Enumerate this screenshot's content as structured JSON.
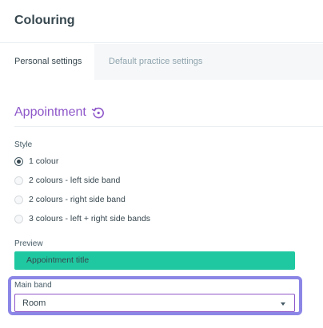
{
  "header": {
    "title": "Colouring"
  },
  "tabs": [
    {
      "label": "Personal settings",
      "active": true
    },
    {
      "label": "Default practice settings",
      "active": false
    }
  ],
  "section": {
    "title": "Appointment",
    "icon": "refresh-icon"
  },
  "style": {
    "label": "Style",
    "options": [
      {
        "label": "1 colour",
        "checked": true
      },
      {
        "label": "2 colours - left side band",
        "checked": false
      },
      {
        "label": "2 colours - right side band",
        "checked": false
      },
      {
        "label": "3 colours - left + right side bands",
        "checked": false
      }
    ]
  },
  "preview": {
    "label": "Preview",
    "appointment_title": "Appointment title",
    "color": "#1fc8a0"
  },
  "main_band": {
    "label": "Main band",
    "value": "Room"
  },
  "colors": {
    "accent": "#8e57c9",
    "highlight": "#8b86e6",
    "text": "#37474f"
  }
}
